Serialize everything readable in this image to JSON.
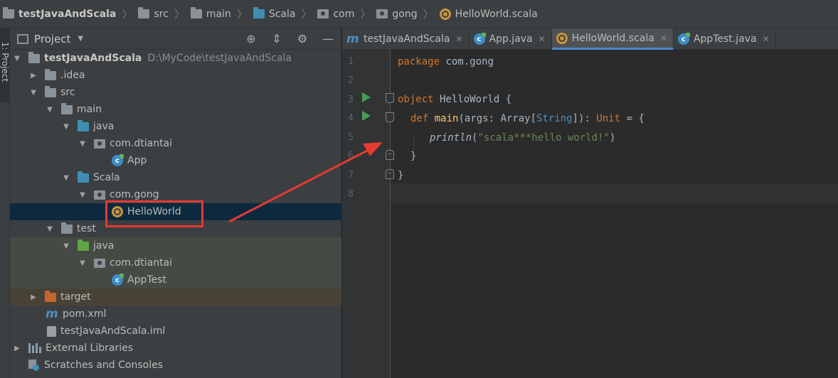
{
  "breadcrumb": {
    "items": [
      "testJavaAndScala",
      "src",
      "main",
      "Scala",
      "com",
      "gong",
      "HelloWorld.scala"
    ]
  },
  "toolstrip": {
    "project_tab": "1: Project"
  },
  "project_panel": {
    "title": "Project",
    "tree": [
      {
        "label": "testJavaAndScala",
        "path": "D:\\MyCode\\testJavaAndScala"
      },
      {
        "label": ".idea"
      },
      {
        "label": "src"
      },
      {
        "label": "main"
      },
      {
        "label": "java"
      },
      {
        "label": "com.dtiantai"
      },
      {
        "label": "App"
      },
      {
        "label": "Scala"
      },
      {
        "label": "com.gong"
      },
      {
        "label": "HelloWorld"
      },
      {
        "label": "test"
      },
      {
        "label": "java"
      },
      {
        "label": "com.dtiantai"
      },
      {
        "label": "AppTest"
      },
      {
        "label": "target"
      },
      {
        "label": "pom.xml"
      },
      {
        "label": "testJavaAndScala.iml"
      },
      {
        "label": "External Libraries"
      },
      {
        "label": "Scratches and Consoles"
      }
    ]
  },
  "editor": {
    "tabs": [
      {
        "label": "testJavaAndScala"
      },
      {
        "label": "App.java"
      },
      {
        "label": "HelloWorld.scala"
      },
      {
        "label": "AppTest.java"
      }
    ],
    "line_numbers": [
      "1",
      "2",
      "3",
      "4",
      "5",
      "6",
      "7",
      "8"
    ],
    "code": {
      "l1_kw": "package",
      "l1_rest": " com.gong",
      "l3_kw": "object",
      "l3_rest": " HelloWorld {",
      "l4_kw": "def",
      "l4_fn": "main",
      "l4_a": "(args: Array[",
      "l4_type": "String",
      "l4_b": "]): ",
      "l4_unit": "Unit",
      "l4_c": " = {",
      "l5_fn": "println",
      "l5_a": "(",
      "l5_str": "\"scala***hello world!\"",
      "l5_b": ")",
      "l6": "}",
      "l7": "}"
    }
  },
  "colors": {
    "annotation_red": "#e33b32",
    "run_green": "#499c54",
    "keyword_orange": "#cc7832"
  }
}
